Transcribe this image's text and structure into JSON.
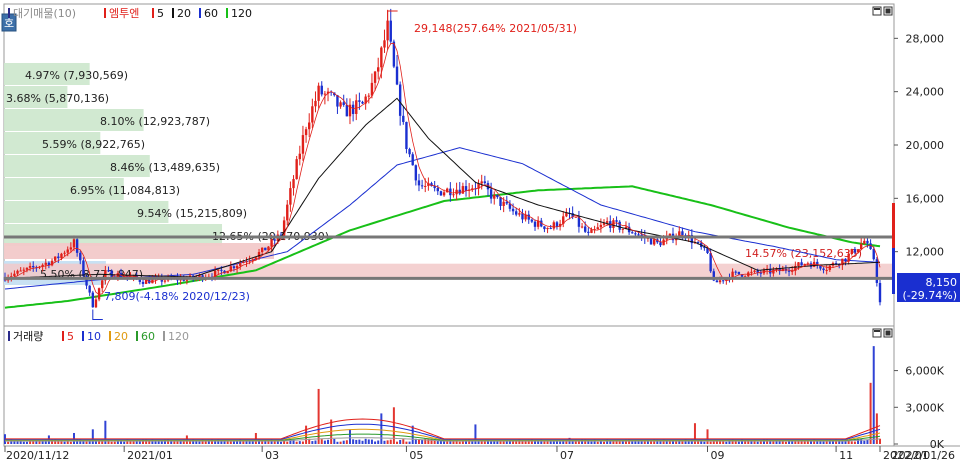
{
  "price_panel": {
    "legend_series": "대기매물(10)",
    "stock_name": "엠투엔",
    "ma_labels": [
      "5",
      "20",
      "60",
      "120"
    ],
    "ma_colors": [
      "#e0201a",
      "#111111",
      "#1a2fd0",
      "#18c018"
    ],
    "icon_label": "호",
    "y_ticks": [
      "28,000",
      "24,000",
      "20,000",
      "16,000",
      "12,000"
    ],
    "high_annotation": "29,148(257.64% 2021/05/31)",
    "low_annotation": "7,809(-4.18% 2020/12/23)",
    "current_price": "8,150",
    "current_change": "(-29.74%)",
    "volume_profile": [
      {
        "label": "4.97% (7,930,569)"
      },
      {
        "label": "3.68% (5,870,136)"
      },
      {
        "label": "8.10% (12,923,787)"
      },
      {
        "label": "5.59% (8,922,765)"
      },
      {
        "label": "8.46% (13,489,635)"
      },
      {
        "label": "6.95% (11,084,813)"
      },
      {
        "label": "9.54% (15,215,809)"
      },
      {
        "label": "12.65% (20,170,930)"
      },
      {
        "label": "14.57% (23,152,635)"
      },
      {
        "label": "5.50% (8,773,847)"
      }
    ]
  },
  "volume_panel": {
    "title": "거래량",
    "ma_labels": [
      "5",
      "10",
      "20",
      "60",
      "120"
    ],
    "ma_colors": [
      "#e0201a",
      "#1a2fd0",
      "#e09a10",
      "#2a9a2a",
      "#999999"
    ],
    "y_ticks": [
      "6,000K",
      "3,000K",
      "0K"
    ]
  },
  "x_axis": {
    "labels": [
      "2020/11/12",
      "2021/01",
      "03",
      "05",
      "07",
      "09",
      "11",
      "2022/01",
      "2022/01/26"
    ]
  },
  "chart_data": {
    "type": "candlestick",
    "price_range": [
      6500,
      30500
    ],
    "volume_range": [
      0,
      8500
    ],
    "high": {
      "value": 29148,
      "date": "2021/05/31"
    },
    "low": {
      "value": 7809,
      "date": "2020/12/23"
    },
    "last_close": 8150,
    "support_line": 10000,
    "resistance_line": 13100,
    "volume_profile_values": [
      4.97,
      3.68,
      8.1,
      5.59,
      8.46,
      6.95,
      9.54,
      12.65,
      14.57,
      5.5
    ],
    "price_path": [
      [
        0,
        10100
      ],
      [
        8,
        10700
      ],
      [
        16,
        11400
      ],
      [
        22,
        12700
      ],
      [
        25,
        10300
      ],
      [
        28,
        8000
      ],
      [
        32,
        10400
      ],
      [
        38,
        10200
      ],
      [
        44,
        9800
      ],
      [
        52,
        9900
      ],
      [
        60,
        10000
      ],
      [
        68,
        10400
      ],
      [
        76,
        11300
      ],
      [
        82,
        12000
      ],
      [
        88,
        13300
      ],
      [
        92,
        17500
      ],
      [
        96,
        21500
      ],
      [
        100,
        24000
      ],
      [
        104,
        23500
      ],
      [
        108,
        22500
      ],
      [
        114,
        23000
      ],
      [
        118,
        25000
      ],
      [
        122,
        28800
      ],
      [
        125,
        24000
      ],
      [
        128,
        20000
      ],
      [
        132,
        17000
      ],
      [
        138,
        16500
      ],
      [
        146,
        16800
      ],
      [
        152,
        17000
      ],
      [
        156,
        16000
      ],
      [
        162,
        15000
      ],
      [
        168,
        14200
      ],
      [
        174,
        13800
      ],
      [
        180,
        14800
      ],
      [
        186,
        13200
      ],
      [
        192,
        14200
      ],
      [
        200,
        13500
      ],
      [
        208,
        12600
      ],
      [
        216,
        13500
      ],
      [
        224,
        11800
      ],
      [
        226,
        9600
      ],
      [
        232,
        10300
      ],
      [
        240,
        10400
      ],
      [
        248,
        10600
      ],
      [
        256,
        11200
      ],
      [
        262,
        10800
      ],
      [
        268,
        11500
      ],
      [
        274,
        12800
      ],
      [
        277,
        11500
      ],
      [
        279,
        8150
      ]
    ],
    "ma20_path": [
      [
        0,
        10000
      ],
      [
        30,
        10300
      ],
      [
        60,
        10100
      ],
      [
        85,
        12000
      ],
      [
        100,
        17500
      ],
      [
        115,
        21500
      ],
      [
        125,
        23500
      ],
      [
        135,
        20500
      ],
      [
        150,
        17200
      ],
      [
        170,
        15500
      ],
      [
        200,
        13600
      ],
      [
        220,
        12700
      ],
      [
        240,
        10600
      ],
      [
        260,
        11000
      ],
      [
        279,
        11200
      ]
    ],
    "ma60_path": [
      [
        0,
        9200
      ],
      [
        30,
        9900
      ],
      [
        60,
        10300
      ],
      [
        90,
        12000
      ],
      [
        110,
        15500
      ],
      [
        125,
        18500
      ],
      [
        145,
        19800
      ],
      [
        165,
        18600
      ],
      [
        190,
        15500
      ],
      [
        220,
        13500
      ],
      [
        245,
        12400
      ],
      [
        265,
        11400
      ],
      [
        279,
        11200
      ]
    ],
    "ma120_path": [
      [
        0,
        7800
      ],
      [
        20,
        8300
      ],
      [
        50,
        9400
      ],
      [
        80,
        10600
      ],
      [
        110,
        13600
      ],
      [
        140,
        15800
      ],
      [
        170,
        16600
      ],
      [
        200,
        16900
      ],
      [
        225,
        15500
      ],
      [
        250,
        13800
      ],
      [
        270,
        12700
      ],
      [
        279,
        12400
      ]
    ],
    "volume_spikes": [
      [
        0,
        800
      ],
      [
        14,
        700
      ],
      [
        22,
        900
      ],
      [
        28,
        1200
      ],
      [
        32,
        1900
      ],
      [
        58,
        700
      ],
      [
        80,
        900
      ],
      [
        96,
        1500
      ],
      [
        100,
        4500
      ],
      [
        104,
        2000
      ],
      [
        110,
        1200
      ],
      [
        120,
        2500
      ],
      [
        124,
        3000
      ],
      [
        130,
        1500
      ],
      [
        150,
        1600
      ],
      [
        180,
        500
      ],
      [
        220,
        1700
      ],
      [
        224,
        1200
      ],
      [
        276,
        5000
      ],
      [
        277,
        8000
      ],
      [
        278,
        2500
      ]
    ]
  }
}
